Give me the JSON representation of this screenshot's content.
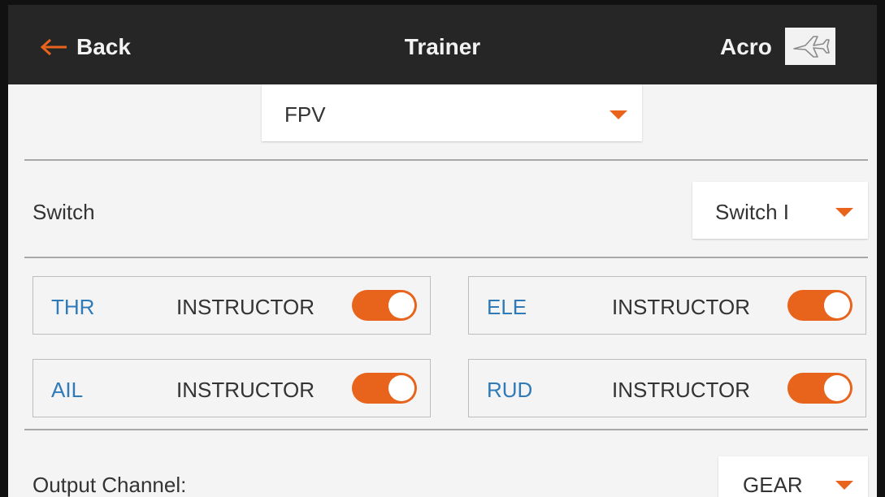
{
  "header": {
    "back_label": "Back",
    "title": "Trainer",
    "model_name": "Acro",
    "model_icon": "airplane-icon"
  },
  "trainer_mode": {
    "selected": "FPV"
  },
  "switch": {
    "label": "Switch",
    "selected": "Switch I"
  },
  "channels": [
    {
      "name": "THR",
      "mode": "INSTRUCTOR",
      "enabled": true
    },
    {
      "name": "ELE",
      "mode": "INSTRUCTOR",
      "enabled": true
    },
    {
      "name": "AIL",
      "mode": "INSTRUCTOR",
      "enabled": true
    },
    {
      "name": "RUD",
      "mode": "INSTRUCTOR",
      "enabled": true
    }
  ],
  "output_channel": {
    "label": "Output Channel:",
    "selected": "GEAR"
  },
  "colors": {
    "header_bg": "#262626",
    "accent": "#e8631c",
    "channel_text": "#2f7ab8",
    "background": "#f4f4f4"
  }
}
